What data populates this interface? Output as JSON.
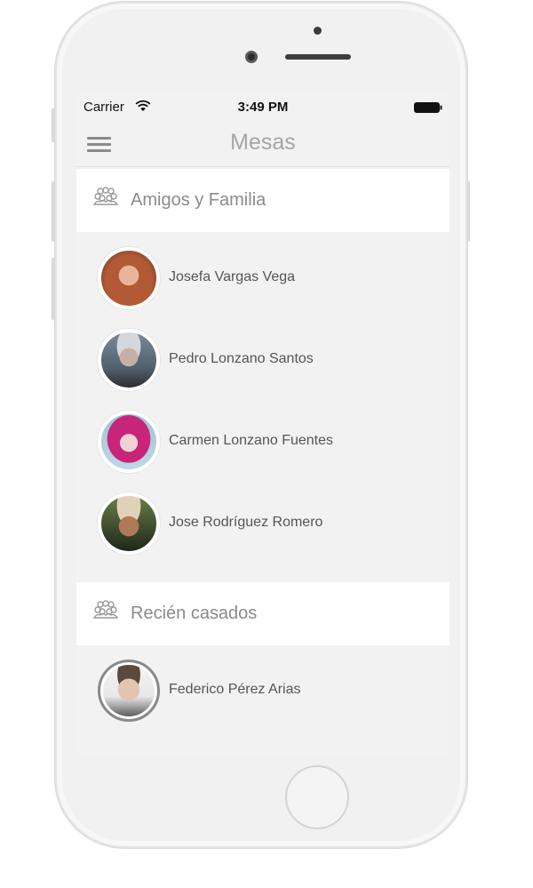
{
  "status_bar": {
    "carrier": "Carrier",
    "time": "3:49 PM"
  },
  "nav": {
    "title": "Mesas",
    "menu_icon": "hamburger-menu-icon"
  },
  "groups": [
    {
      "title": "Amigos y Familia",
      "icon": "group-people-icon",
      "guests": [
        {
          "name": "Josefa Vargas Vega",
          "avatar": "avatar-photo"
        },
        {
          "name": "Pedro Lonzano Santos",
          "avatar": "avatar-photo"
        },
        {
          "name": "Carmen Lonzano Fuentes",
          "avatar": "avatar-photo"
        },
        {
          "name": "Jose Rodríguez Romero",
          "avatar": "avatar-photo"
        }
      ]
    },
    {
      "title": "Recién casados",
      "icon": "group-people-icon",
      "guests": [
        {
          "name": "Federico Pérez Arias",
          "avatar": "avatar-photo",
          "selected": true
        }
      ]
    }
  ],
  "colors": {
    "screen_bg": "#f2f2f2",
    "header_bg": "#ffffff",
    "title_gray": "#a6a6a6",
    "text_gray": "#555555"
  }
}
